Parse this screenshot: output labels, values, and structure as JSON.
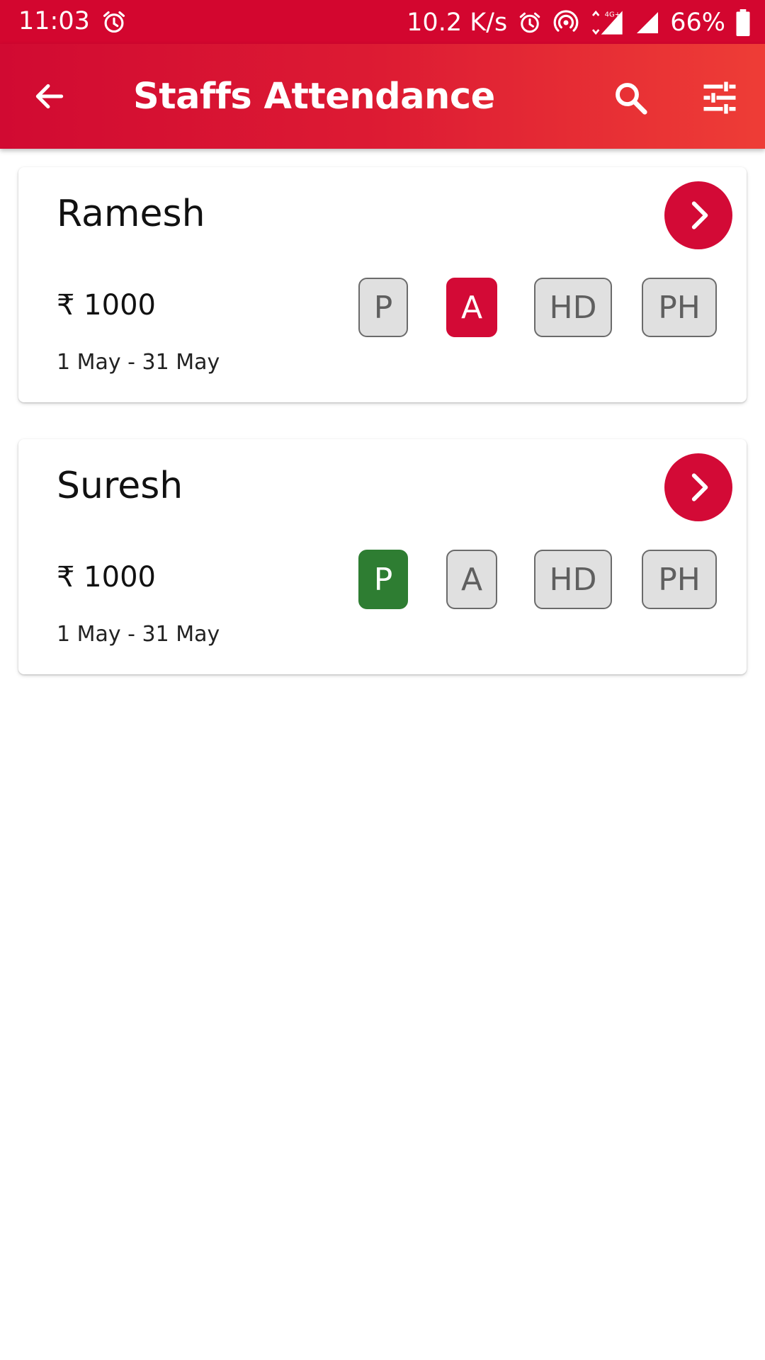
{
  "status_bar": {
    "time": "11:03",
    "speed": "10.2 K/s",
    "network": "4G+",
    "battery": "66%"
  },
  "app_bar": {
    "title": "Staffs Attendance",
    "back_icon": "arrow-back-icon",
    "search_icon": "search-icon",
    "filter_icon": "tune-icon"
  },
  "staff": [
    {
      "name": "Ramesh",
      "amount": "₹ 1000",
      "period": "1 May - 31 May",
      "status": {
        "p": "P",
        "a": "A",
        "hd": "HD",
        "ph": "PH"
      },
      "selected": "A"
    },
    {
      "name": "Suresh",
      "amount": "₹ 1000",
      "period": "1 May - 31 May",
      "status": {
        "p": "P",
        "a": "A",
        "hd": "HD",
        "ph": "PH"
      },
      "selected": "P"
    }
  ],
  "colors": {
    "primary": "#d30a36",
    "present": "#2e7d32",
    "chip_bg": "#e0e0e0",
    "chip_border": "#6b6b6b"
  }
}
